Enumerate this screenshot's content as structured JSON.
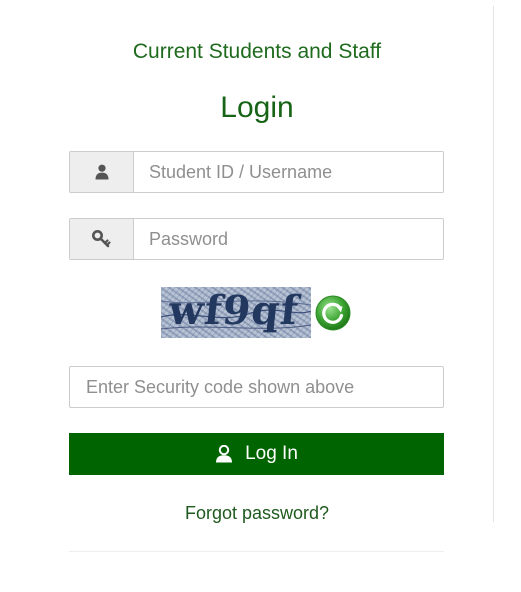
{
  "header": {
    "subtitle": "Current Students and Staff",
    "title": "Login"
  },
  "form": {
    "username": {
      "placeholder": "Student ID / Username",
      "value": "",
      "icon": "user-icon"
    },
    "password": {
      "placeholder": "Password",
      "value": "",
      "icon": "key-icon"
    },
    "captcha": {
      "text": "wf9qf",
      "refresh_icon": "refresh-icon"
    },
    "security_code": {
      "placeholder": "Enter Security code shown above",
      "value": ""
    },
    "login_button": {
      "label": "Log In",
      "icon": "user-icon"
    },
    "forgot_link": "Forgot password?"
  },
  "colors": {
    "accent": "#006400",
    "heading": "#1e6b1e",
    "addon_bg": "#eeeeee",
    "border": "#cccccc"
  }
}
